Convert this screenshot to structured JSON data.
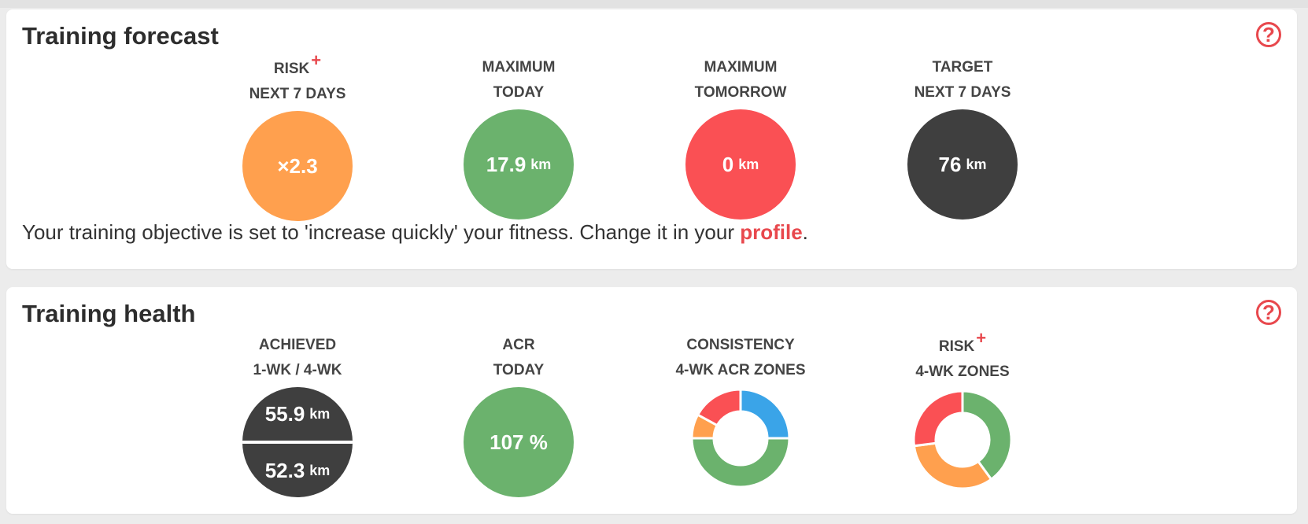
{
  "forecast": {
    "title": "Training forecast",
    "help": "?",
    "metrics": [
      {
        "label1": "RISK",
        "plus": "+",
        "label2": "NEXT 7 DAYS",
        "value": "×2.3",
        "unit": "",
        "color": "#ffa04e"
      },
      {
        "label1": "MAXIMUM",
        "label2": "TODAY",
        "value": "17.9",
        "unit": "km",
        "color": "#6bb26d"
      },
      {
        "label1": "MAXIMUM",
        "label2": "TOMORROW",
        "value": "0",
        "unit": "km",
        "color": "#fa5054"
      },
      {
        "label1": "TARGET",
        "label2": "NEXT 7 DAYS",
        "value": "76",
        "unit": "km",
        "color": "#3f3f3f"
      }
    ],
    "objective_prefix": "Your training objective is set to 'increase quickly' your fitness. Change it in your ",
    "objective_link": "profile",
    "objective_suffix": "."
  },
  "health": {
    "title": "Training health",
    "help": "?",
    "achieved": {
      "label1": "ACHIEVED",
      "label2": "1-WK / 4-WK",
      "value1": "55.9",
      "value2": "52.3",
      "unit": "km"
    },
    "acr": {
      "label1": "ACR",
      "label2": "TODAY",
      "value": "107 %",
      "color": "#6bb26d"
    },
    "consistency": {
      "label1": "CONSISTENCY",
      "label2": "4-WK ACR ZONES",
      "segments": [
        {
          "zone": "blue",
          "fraction": 0.25,
          "color": "#3aa4e8"
        },
        {
          "zone": "green",
          "fraction": 0.5,
          "color": "#6bb26d"
        },
        {
          "zone": "orange",
          "fraction": 0.08,
          "color": "#ffa04e"
        },
        {
          "zone": "red",
          "fraction": 0.17,
          "color": "#fa5054"
        }
      ]
    },
    "risk": {
      "label1": "RISK",
      "plus": "+",
      "label2": "4-WK ZONES",
      "segments": [
        {
          "zone": "green",
          "fraction": 0.4,
          "color": "#6bb26d"
        },
        {
          "zone": "orange",
          "fraction": 0.33,
          "color": "#ffa04e"
        },
        {
          "zone": "red",
          "fraction": 0.27,
          "color": "#fa5054"
        }
      ]
    }
  }
}
